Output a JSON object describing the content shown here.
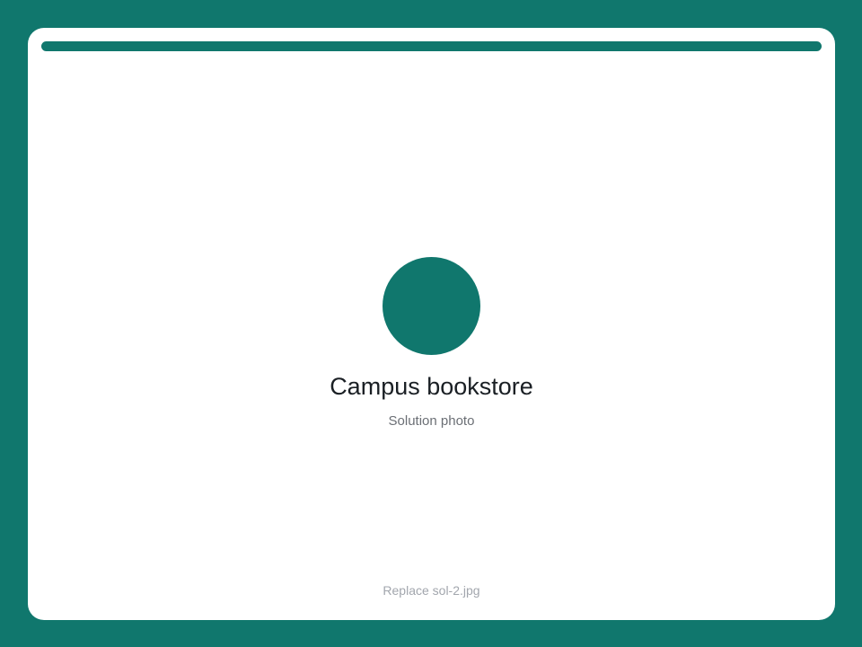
{
  "colors": {
    "accent": "#10776d",
    "card_background": "#ffffff",
    "title_text": "#1a1f24",
    "subtitle_text": "#6b6f75",
    "footer_text": "#a2a6ad"
  },
  "card": {
    "title": "Campus bookstore",
    "subtitle": "Solution photo",
    "footer_note": "Replace sol-2.jpg"
  }
}
